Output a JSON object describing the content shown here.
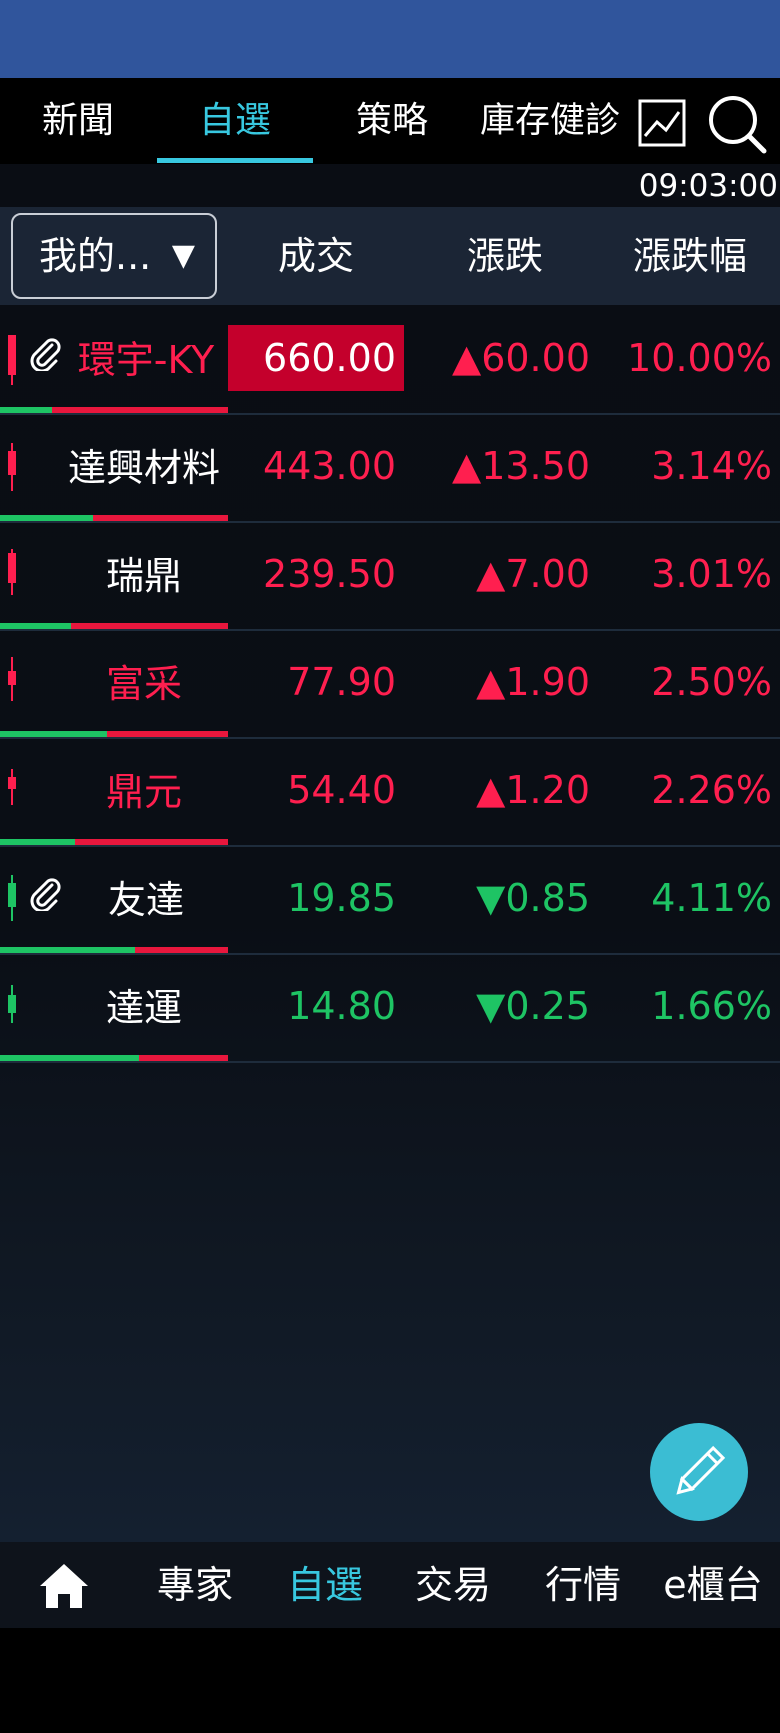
{
  "top_tabs": [
    {
      "label": "新聞"
    },
    {
      "label": "自選"
    },
    {
      "label": "策略"
    },
    {
      "label": "庫存健診"
    }
  ],
  "time": "09:03:00",
  "header": {
    "group": "我的...",
    "group_arrow": "▼",
    "col_price": "成交",
    "col_change": "漲跌",
    "col_pct": "漲跌幅"
  },
  "rows": [
    {
      "name": "環宇-KY",
      "price": "660.00",
      "change": "▲60.00",
      "pct": "10.00%",
      "direction": "up",
      "name_color": "up",
      "highlight": true,
      "clip": true,
      "buy_ratio": 0.23
    },
    {
      "name": "達興材料",
      "price": "443.00",
      "change": "▲13.50",
      "pct": "3.14%",
      "direction": "up",
      "name_color": "white",
      "highlight": false,
      "clip": false,
      "buy_ratio": 0.41
    },
    {
      "name": "瑞鼎",
      "price": "239.50",
      "change": "▲7.00",
      "pct": "3.01%",
      "direction": "up",
      "name_color": "white",
      "highlight": false,
      "clip": false,
      "buy_ratio": 0.31
    },
    {
      "name": "富采",
      "price": "77.90",
      "change": "▲1.90",
      "pct": "2.50%",
      "direction": "up",
      "name_color": "up",
      "highlight": false,
      "clip": false,
      "buy_ratio": 0.47
    },
    {
      "name": "鼎元",
      "price": "54.40",
      "change": "▲1.20",
      "pct": "2.26%",
      "direction": "up",
      "name_color": "up",
      "highlight": false,
      "clip": false,
      "buy_ratio": 0.33
    },
    {
      "name": "友達",
      "price": "19.85",
      "change": "▼0.85",
      "pct": "4.11%",
      "direction": "down",
      "name_color": "white",
      "highlight": false,
      "clip": true,
      "buy_ratio": 0.59
    },
    {
      "name": "達運",
      "price": "14.80",
      "change": "▼0.25",
      "pct": "1.66%",
      "direction": "down",
      "name_color": "white",
      "highlight": false,
      "clip": false,
      "buy_ratio": 0.61
    }
  ],
  "bottom_nav": [
    {
      "label": "專家"
    },
    {
      "label": "自選"
    },
    {
      "label": "交易"
    },
    {
      "label": "行情"
    },
    {
      "label": "e櫃台"
    }
  ],
  "icons": {
    "chart": "line-chart-icon",
    "search": "search-icon",
    "home": "home-icon",
    "edit": "pencil-icon",
    "clip": "paperclip-icon"
  },
  "colors": {
    "accent": "#38c8e0",
    "up": "#ff1f4f",
    "down": "#1ec464",
    "highlight": "#c4002c",
    "status_bar": "#30559c"
  }
}
